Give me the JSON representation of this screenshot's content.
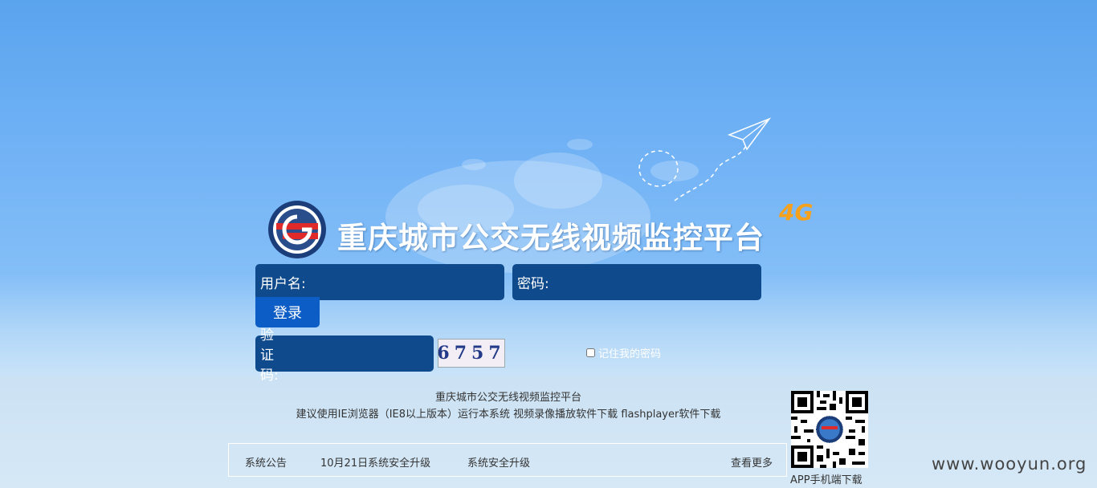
{
  "header": {
    "title": "重庆城市公交无线视频监控平台",
    "badge": "4G"
  },
  "login": {
    "username_label": "用户名:",
    "password_label": "密码:",
    "login_button": "登录",
    "captcha_label": "验证码:",
    "captcha_value": "6757",
    "remember_label": "记住我的密码"
  },
  "footer": {
    "title": "重庆城市公交无线视频监控平台",
    "line2_prefix": "建议使用IE浏览器（IE8以上版本）运行本系统",
    "download_video": "视频录像播放软件下载",
    "download_flash": "flashplayer软件下载",
    "notices": [
      "系统公告",
      "10月21日系统安全升级",
      "系统安全升级"
    ],
    "more": "查看更多",
    "qr_caption": "APP手机端下载"
  },
  "watermark": "www.wooyun.org",
  "colors": {
    "field_bg": "#0f4b8c",
    "button_bg": "#0d5dc6",
    "badge": "#f5a11c"
  }
}
